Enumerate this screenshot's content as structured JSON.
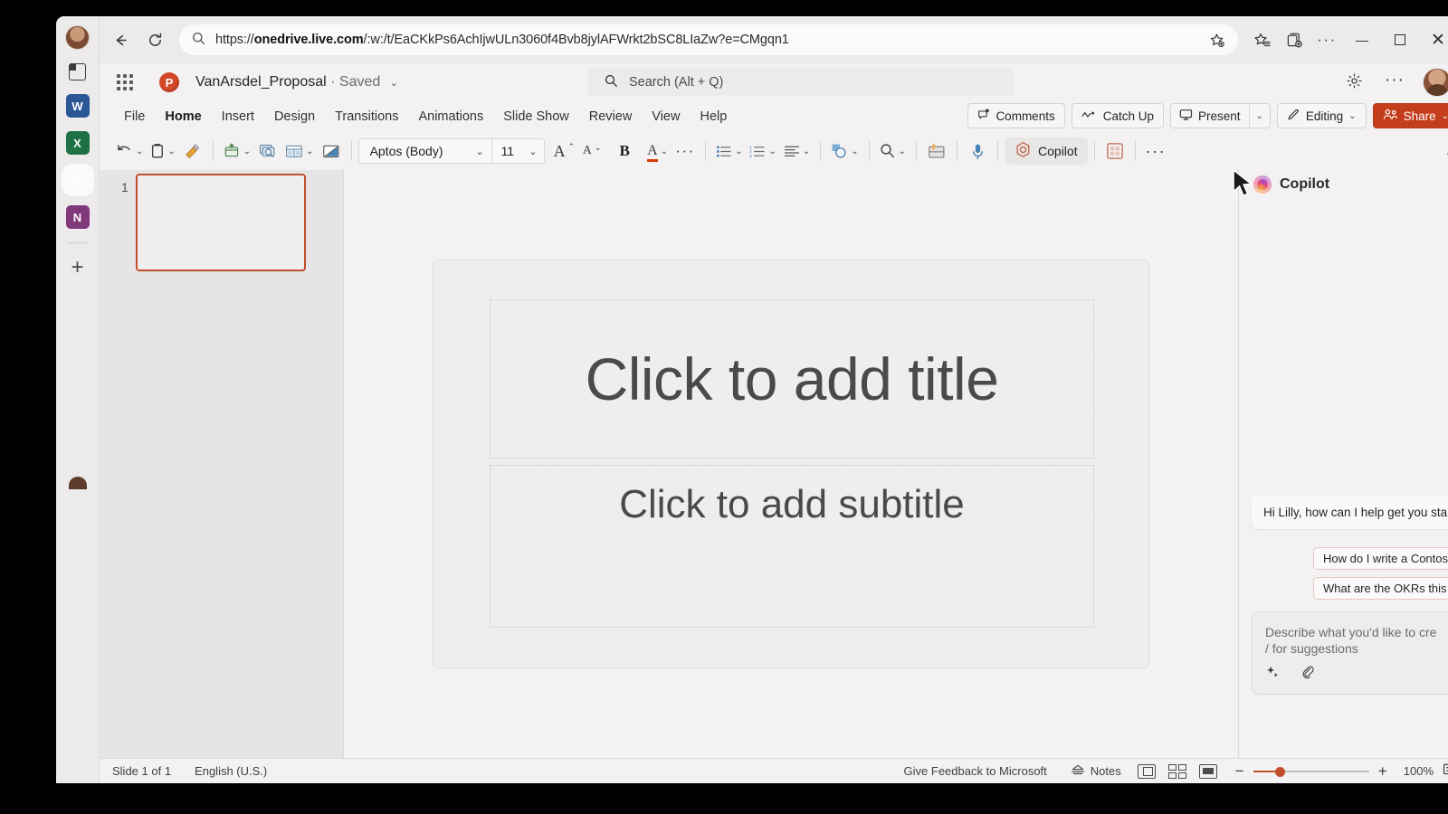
{
  "browser": {
    "back_icon": "back-arrow-icon",
    "reload_icon": "reload-icon",
    "url": "https://onedrive.live.com/:w:/t/EaCKkPs6AchIjwULn3060f4Bvb8jylAFWrkt2bSC8LIaZw?e=CMgqn1",
    "url_bold_part": "onedrive.live.com",
    "url_prefix": "https://",
    "url_suffix": "/:w:/t/EaCKkPs6AchIjwULn3060f4Bvb8jylAFWrkt2bSC8LIaZw?e=CMgqn1",
    "toolbar_icons": [
      "add-favorite-icon",
      "favorites-icon",
      "collections-icon",
      "browser-more-icon"
    ],
    "window_controls": [
      "minimize-button",
      "maximize-button",
      "close-button"
    ],
    "sidebar": {
      "items": [
        {
          "name": "profile-avatar",
          "label": ""
        },
        {
          "name": "copilot-sidebar-icon",
          "label": ""
        },
        {
          "name": "word-app-icon",
          "label": "W"
        },
        {
          "name": "excel-app-icon",
          "label": "X"
        },
        {
          "name": "powerpoint-app-icon",
          "label": "P"
        },
        {
          "name": "onenote-app-icon",
          "label": "N"
        },
        {
          "name": "add-app-button",
          "label": "+"
        }
      ]
    }
  },
  "office": {
    "app_badge": "P",
    "doc_title": "VanArsdel_Proposal",
    "save_state": "· Saved",
    "title_chevron": "⌄",
    "search_placeholder": "Search (Alt + Q)",
    "gear_icon": "settings-gear-icon",
    "more_icon": "header-more-icon",
    "ribbon_tabs": [
      {
        "label": "File",
        "active": false
      },
      {
        "label": "Home",
        "active": true
      },
      {
        "label": "Insert",
        "active": false
      },
      {
        "label": "Design",
        "active": false
      },
      {
        "label": "Transitions",
        "active": false
      },
      {
        "label": "Animations",
        "active": false
      },
      {
        "label": "Slide Show",
        "active": false
      },
      {
        "label": "Review",
        "active": false
      },
      {
        "label": "View",
        "active": false
      },
      {
        "label": "Help",
        "active": false
      }
    ],
    "ribbon_actions": {
      "comments": "Comments",
      "catch_up": "Catch Up",
      "present": "Present",
      "editing": "Editing",
      "share": "Share"
    },
    "toolbar": {
      "undo": "undo-icon",
      "paste": "paste-icon",
      "format_painter": "format-painter-icon",
      "new_slide": "new-slide-icon",
      "reuse_slides": "reuse-slides-icon",
      "layout": "slide-layout-icon",
      "reset": "reset-slide-icon",
      "font_name": "Aptos (Body)",
      "font_size": "11",
      "grow_font": "grow-font-icon",
      "shrink_font": "shrink-font-icon",
      "bold": "B",
      "font_color": "font-color-icon",
      "more_font": "font-more-icon",
      "bullets": "bullets-icon",
      "numbering": "numbering-icon",
      "align": "align-left-icon",
      "shapes": "shapes-icon",
      "find": "find-icon",
      "designer": "designer-icon",
      "dictate": "dictate-icon",
      "copilot": "Copilot",
      "add_in": "add-in-icon",
      "toolbar_more": "toolbar-more-icon",
      "collapse_ribbon": "collapse-ribbon-icon"
    }
  },
  "thumbnails": {
    "slides": [
      {
        "number": "1"
      }
    ]
  },
  "slide": {
    "title_placeholder": "Click to add title",
    "subtitle_placeholder": "Click to add subtitle"
  },
  "copilot": {
    "panel_title": "Copilot",
    "logo": "copilot-logo-icon",
    "greeting": "Hi Lilly, how can I help get you start",
    "suggestions": [
      "How do I write a Contos",
      "What are the OKRs this"
    ],
    "compose_placeholder_line1": "Describe what you'd like to cre",
    "compose_placeholder_line2": "/ for suggestions",
    "compose_icons": [
      "prompt-gallery-icon",
      "attach-file-icon"
    ]
  },
  "statusbar": {
    "slide_count": "Slide 1 of 1",
    "language": "English (U.S.)",
    "feedback": "Give Feedback to Microsoft",
    "notes": "Notes",
    "views": [
      "normal-view-icon",
      "slide-sorter-view-icon",
      "reading-view-icon"
    ],
    "zoom_out": "−",
    "zoom_in": "+",
    "zoom_level": "100%",
    "fit_to_window": "fit-slide-icon"
  },
  "colors": {
    "accent_orange": "#c0502c",
    "share_red": "#c43e1c",
    "ppt_red": "#d24726",
    "app_bg": "#f3f1f1",
    "thumb_pane_bg": "#e6e4e4"
  }
}
